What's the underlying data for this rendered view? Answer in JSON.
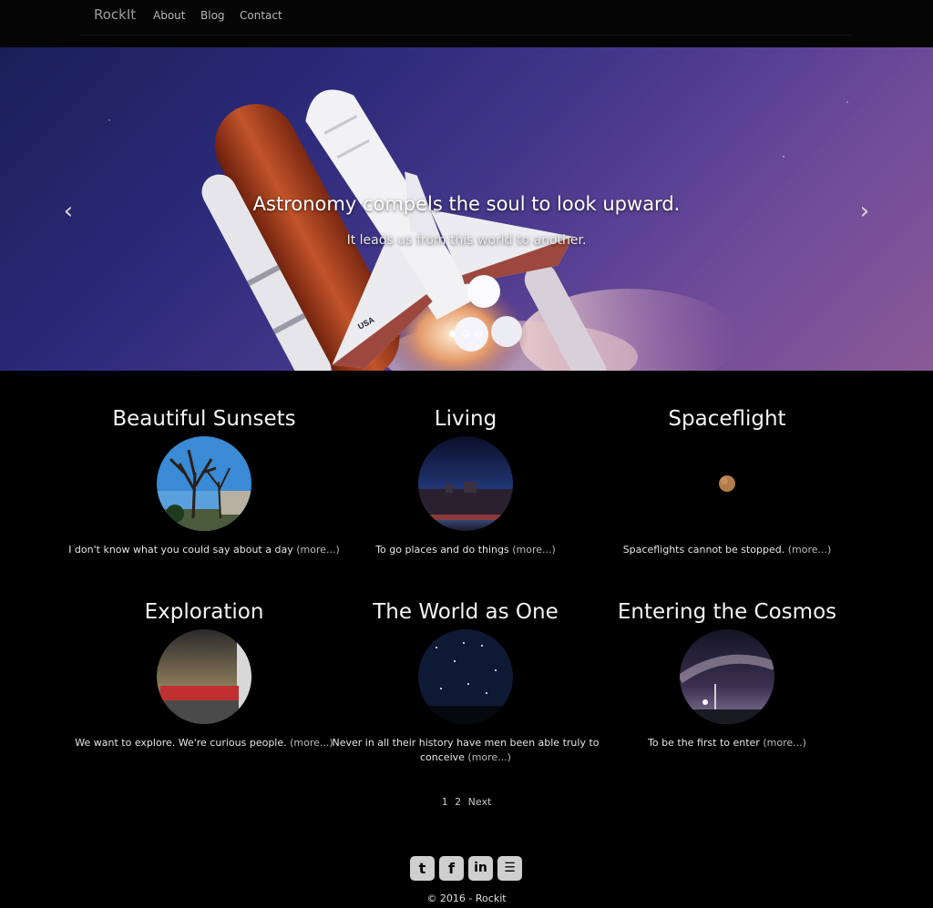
{
  "nav": {
    "brand": "RockIt",
    "links": [
      "About",
      "Blog",
      "Contact"
    ]
  },
  "carousel": {
    "title": "Astronomy compels the soul to look upward.",
    "subtitle": "It leads us from this world to another.",
    "prev_icon": "chevron-left-icon",
    "next_icon": "chevron-right-icon",
    "prev_glyph": "‹",
    "next_glyph": "›",
    "active_slide": 1,
    "slide_count": 3
  },
  "cards": [
    {
      "title": "Beautiful Sunsets",
      "text": "I don't know what you could say about a day",
      "more": "(more...)"
    },
    {
      "title": "Living",
      "text": "To go places and do things",
      "more": "(more...)"
    },
    {
      "title": "Spaceflight",
      "text": "Spaceflights cannot be stopped.",
      "more": "(more...)"
    },
    {
      "title": "Exploration",
      "text": "We want to explore. We're curious people.",
      "more": "(more...)"
    },
    {
      "title": "The World as One",
      "text": "Never in all their history have men been able truly to conceive",
      "more": "(more...)"
    },
    {
      "title": "Entering the Cosmos",
      "text": "To be the first to enter",
      "more": "(more...)"
    }
  ],
  "pagination": {
    "pages": [
      "1",
      "2"
    ],
    "next": "Next"
  },
  "footer": {
    "social": [
      {
        "name": "twitter-icon",
        "glyph": "t"
      },
      {
        "name": "facebook-icon",
        "glyph": "f"
      },
      {
        "name": "linkedin-icon",
        "glyph": "in"
      },
      {
        "name": "github-icon",
        "glyph": "☰"
      }
    ],
    "copyright": "© 2016 - Rockit"
  },
  "colors": {
    "background": "#000000",
    "navbar": "#050505",
    "link_muted": "#bcbcbc"
  }
}
